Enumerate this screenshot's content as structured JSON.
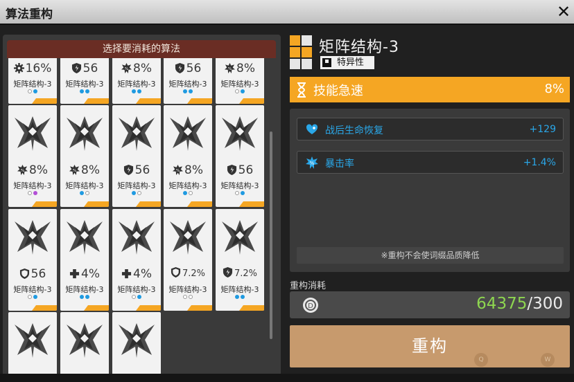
{
  "window": {
    "title": "算法重构",
    "close_icon": "close-icon"
  },
  "left": {
    "header": "选择要消耗的算法"
  },
  "cards": [
    {
      "stat": "16%",
      "name": "矩阵结构-3",
      "icon": "gear-icon",
      "dots": [
        "white",
        "blue"
      ],
      "row": 0,
      "col": 0,
      "emblem": false
    },
    {
      "stat": "56",
      "name": "矩阵结构-3",
      "icon": "shield-icon",
      "dots": [
        "blue",
        "blue"
      ],
      "row": 0,
      "col": 1,
      "emblem": false
    },
    {
      "stat": "8%",
      "name": "矩阵结构-3",
      "icon": "crit-icon",
      "dots": [
        "blue",
        "blue"
      ],
      "row": 0,
      "col": 2,
      "emblem": false
    },
    {
      "stat": "56",
      "name": "矩阵结构-3",
      "icon": "shield-icon",
      "dots": [
        "blue",
        "blue"
      ],
      "row": 0,
      "col": 3,
      "emblem": false
    },
    {
      "stat": "8%",
      "name": "矩阵结构-3",
      "icon": "crit-icon",
      "dots": [
        "white",
        "blue"
      ],
      "row": 0,
      "col": 4,
      "emblem": false
    },
    {
      "stat": "8%",
      "name": "矩阵结构-3",
      "icon": "crit-icon",
      "dots": [
        "white",
        "purple"
      ],
      "row": 1,
      "col": 0,
      "emblem": true
    },
    {
      "stat": "8%",
      "name": "矩阵结构-3",
      "icon": "crit-icon",
      "dots": [
        "blue",
        "white"
      ],
      "row": 1,
      "col": 1,
      "emblem": true
    },
    {
      "stat": "56",
      "name": "矩阵结构-3",
      "icon": "shield-icon",
      "dots": [
        "blue",
        "white"
      ],
      "row": 1,
      "col": 2,
      "emblem": true
    },
    {
      "stat": "8%",
      "name": "矩阵结构-3",
      "icon": "crit-icon",
      "dots": [
        "blue",
        "white"
      ],
      "row": 1,
      "col": 3,
      "emblem": true
    },
    {
      "stat": "56",
      "name": "矩阵结构-3",
      "icon": "shield-icon",
      "dots": [
        "white",
        "blue"
      ],
      "row": 1,
      "col": 4,
      "emblem": true
    },
    {
      "stat": "56",
      "name": "矩阵结构-3",
      "icon": "shield-plain-icon",
      "dots": [
        "white",
        "blue"
      ],
      "row": 2,
      "col": 0,
      "emblem": true
    },
    {
      "stat": "4%",
      "name": "矩阵结构-3",
      "icon": "plus-icon",
      "dots": [
        "blue",
        "blue"
      ],
      "row": 2,
      "col": 1,
      "emblem": true
    },
    {
      "stat": "4%",
      "name": "矩阵结构-3",
      "icon": "plus-icon",
      "dots": [
        "white",
        "blue"
      ],
      "row": 2,
      "col": 2,
      "emblem": true
    },
    {
      "stat": "7.2%",
      "name": "矩阵结构-3",
      "icon": "shield-plain-icon",
      "dots": [
        "white",
        "white"
      ],
      "row": 2,
      "col": 3,
      "emblem": true,
      "small": true
    },
    {
      "stat": "7.2%",
      "name": "矩阵结构-3",
      "icon": "shield-icon",
      "dots": [
        "blue",
        "blue"
      ],
      "row": 2,
      "col": 4,
      "emblem": true,
      "small": true
    },
    {
      "stat": "",
      "name": "",
      "icon": "",
      "dots": [],
      "row": 3,
      "col": 0,
      "emblem": true
    },
    {
      "stat": "",
      "name": "",
      "icon": "",
      "dots": [],
      "row": 3,
      "col": 1,
      "emblem": true
    },
    {
      "stat": "",
      "name": "",
      "icon": "",
      "dots": [],
      "row": 3,
      "col": 2,
      "emblem": true
    }
  ],
  "right": {
    "name": "矩阵结构-3",
    "tag": "特异性",
    "main_stat": {
      "label": "技能急速",
      "value": "8%",
      "icon": "hourglass-icon"
    },
    "sub_stats": [
      {
        "label": "战后生命恢复",
        "value": "+129",
        "icon": "heart-icon"
      },
      {
        "label": "暴击率",
        "value": "+1.4%",
        "icon": "crit-icon"
      }
    ],
    "note": "※重构不会使词缀品质降低",
    "cost_label": "重构消耗",
    "cost_have": "64375",
    "cost_need": "/300",
    "button": "重构",
    "hint_q": "Q",
    "hint_w": "W"
  },
  "colors": {
    "accent": "#f5a623",
    "substat": "#2aa7e8",
    "have": "#8ed650",
    "header": "#6a2d24",
    "button": "#c79a6d"
  }
}
